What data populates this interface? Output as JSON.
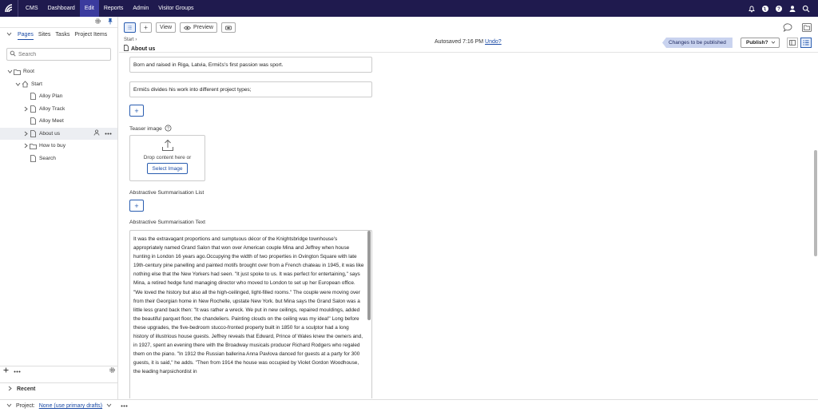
{
  "nav": {
    "brand": "CMS",
    "items": [
      {
        "label": "Dashboard",
        "active": false
      },
      {
        "label": "Edit",
        "active": true
      },
      {
        "label": "Reports",
        "active": false
      },
      {
        "label": "Admin",
        "active": false
      },
      {
        "label": "Visitor Groups",
        "active": false
      }
    ],
    "icons": [
      "bell-icon",
      "globe-icon",
      "help-icon",
      "user-icon",
      "search-icon"
    ]
  },
  "sidebar": {
    "tabs": [
      "Pages",
      "Sites",
      "Tasks",
      "Project Items"
    ],
    "active_tab": "Pages",
    "search_placeholder": "Search",
    "tree": [
      {
        "label": "Root",
        "level": 0,
        "toggle": "open",
        "icon": "folder-icon"
      },
      {
        "label": "Start",
        "level": 1,
        "toggle": "open",
        "icon": "home-icon"
      },
      {
        "label": "Alloy Plan",
        "level": 2,
        "toggle": "none",
        "icon": "page-icon"
      },
      {
        "label": "Alloy Track",
        "level": 2,
        "toggle": "closed",
        "icon": "page-icon"
      },
      {
        "label": "Alloy Meet",
        "level": 2,
        "toggle": "none",
        "icon": "page-icon"
      },
      {
        "label": "About us",
        "level": 2,
        "toggle": "closed",
        "icon": "page-icon",
        "selected": true
      },
      {
        "label": "How to buy",
        "level": 2,
        "toggle": "closed",
        "icon": "folder-icon"
      },
      {
        "label": "Search",
        "level": 2,
        "toggle": "none",
        "icon": "page-icon"
      }
    ],
    "recent_label": "Recent"
  },
  "toolbar": {
    "view_label": "View",
    "preview_label": "Preview",
    "breadcrumb": "Start",
    "page_title": "About us",
    "autosaved_text": "Autosaved 7:16 PM",
    "undo_label": "Undo?",
    "status_label": "Changes to be published",
    "publish_label": "Publish?"
  },
  "content": {
    "field1_text": "Born and raised in Riga, Latvia, Ermičs's first passion was sport.",
    "field2_text": "Ermičs divides his work into different project types;",
    "teaser_label": "Teaser image",
    "drop_text": "Drop content here or",
    "select_image_label": "Select Image",
    "list_label": "Abstractive Summarisation List",
    "text_label": "Abstractive Summarisation Text",
    "summary_text": "It was the extravagant proportions and sumptuous décor of the Knightsbridge townhouse's appropriately named Grand Salon that won over American couple Mina and Jeffrey when house hunting in London 16 years ago.Occupying the width of two properties in Ovington Square with late 19th-century pine panelling and painted motifs brought over from a French chateau in 1945, it was like nothing else that the New Yorkers had seen. \"It just spoke to us. It was perfect for entertaining,\" says Mina, a retired hedge fund managing director who moved to London to set up her European office. \"We loved the history but also all the high-ceilinged, light-filled rooms.\" The couple were moving over from their Georgian home in New Rochelle, upstate New York. but Mina says the Grand Salon was a little less grand back then: \"It was rather a wreck. We put in new ceilings, repaired mouldings, added the beautiful parquet floor, the chandeliers. Painting clouds on the ceiling was my idea!\" Long before these upgrades, the five-bedroom stucco-fronted property built in 1850 for a sculptor had a long history of illustrious house guests. Jeffrey reveals that Edward, Prince of Wales knew the owners and, in 1927, spent an evening there with the Broadway musicals producer Richard Rodgers who regaled them on the piano. \"In 1912 the Russian ballerina Anna Pavlova danced for guests at a party for 300 guests, it is said,\" he adds. \"Then from 1914 the house was occupied by Violet Gordon Woodhouse, the leading harpsichordist in"
  },
  "footer": {
    "project_label": "Project:",
    "project_value": "None (use primary drafts)"
  }
}
